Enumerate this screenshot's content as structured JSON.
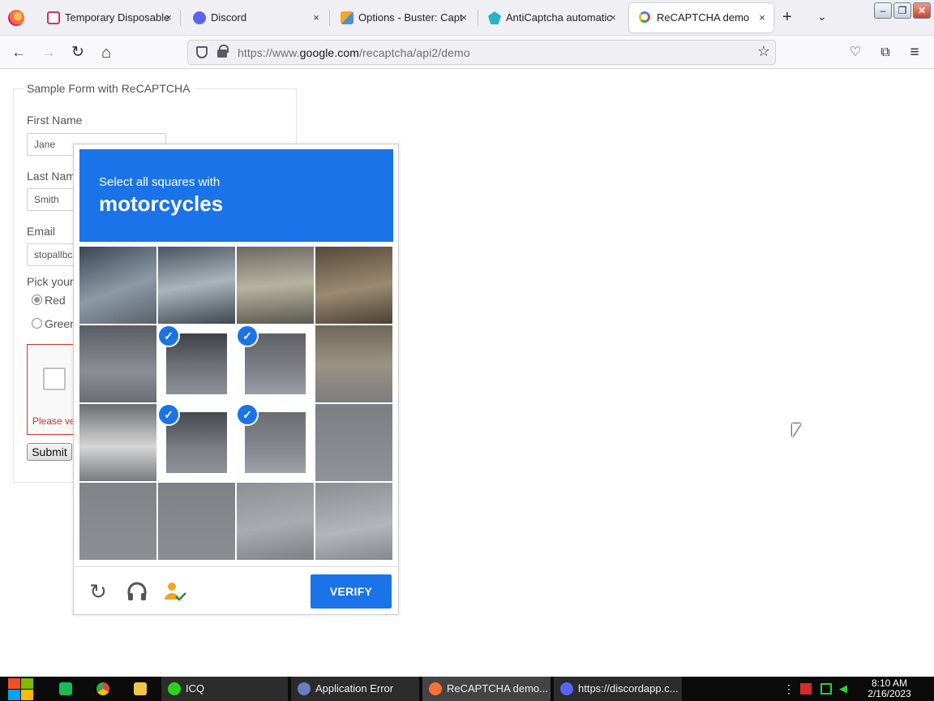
{
  "browser": {
    "tabs": [
      {
        "title": "Temporary Disposable",
        "icon_color": "#d9325a"
      },
      {
        "title": "Discord",
        "icon_color": "#5865f2"
      },
      {
        "title": "Options - Buster: Capt",
        "icon_color": "#f5a623"
      },
      {
        "title": "AntiCaptcha automatic",
        "icon_color": "#25b4c9"
      },
      {
        "title": "ReCAPTCHA demo",
        "icon_color": "#4285f4"
      }
    ],
    "tab_close_glyph": "×",
    "new_tab_glyph": "+",
    "tab_list_glyph": "⌄",
    "window_buttons": {
      "minimize": "–",
      "restore": "❐",
      "close": "✕"
    }
  },
  "navbar": {
    "back_glyph": "←",
    "forward_glyph": "→",
    "reload_glyph": "↻",
    "home_glyph": "⌂",
    "url_prefix": "https://www.",
    "url_domain": "google.com",
    "url_path": "/recaptcha/api2/demo",
    "bookmark_glyph": "☆",
    "pocket_glyph": "♡",
    "extensions_glyph": "⧉",
    "menu_glyph": "≡"
  },
  "form": {
    "legend": "Sample Form with ReCAPTCHA",
    "first_name_label": "First Name",
    "first_name_value": "Jane",
    "last_name_label": "Last Nam",
    "last_name_value": "Smith",
    "email_label": "Email",
    "email_value": "stopallbc",
    "pick_label": "Pick your",
    "radio_red": "Red",
    "radio_green": "Green",
    "recaptcha_error": "Please ve",
    "submit_label": "Submit"
  },
  "challenge": {
    "instruction": "Select all squares with",
    "target": "motorcycles",
    "selected_tiles": [
      5,
      6,
      9,
      10
    ],
    "check_glyph": "✓",
    "reload_glyph": "↻",
    "audio_glyph": "🎧",
    "verify_label": "VERIFY",
    "accent_color": "#1a73e8"
  },
  "taskbar": {
    "tasks": [
      {
        "label": "ICQ",
        "icon_color": "#2bd31e"
      },
      {
        "label": "Application Error",
        "icon_color": "#6a7fbf"
      },
      {
        "label": "ReCAPTCHA demo...",
        "icon_color": "#ff7139"
      },
      {
        "label": "https://discordapp.c...",
        "icon_color": "#5865f2"
      }
    ],
    "clock_time": "8:10 AM",
    "clock_date": "2/16/2023"
  }
}
